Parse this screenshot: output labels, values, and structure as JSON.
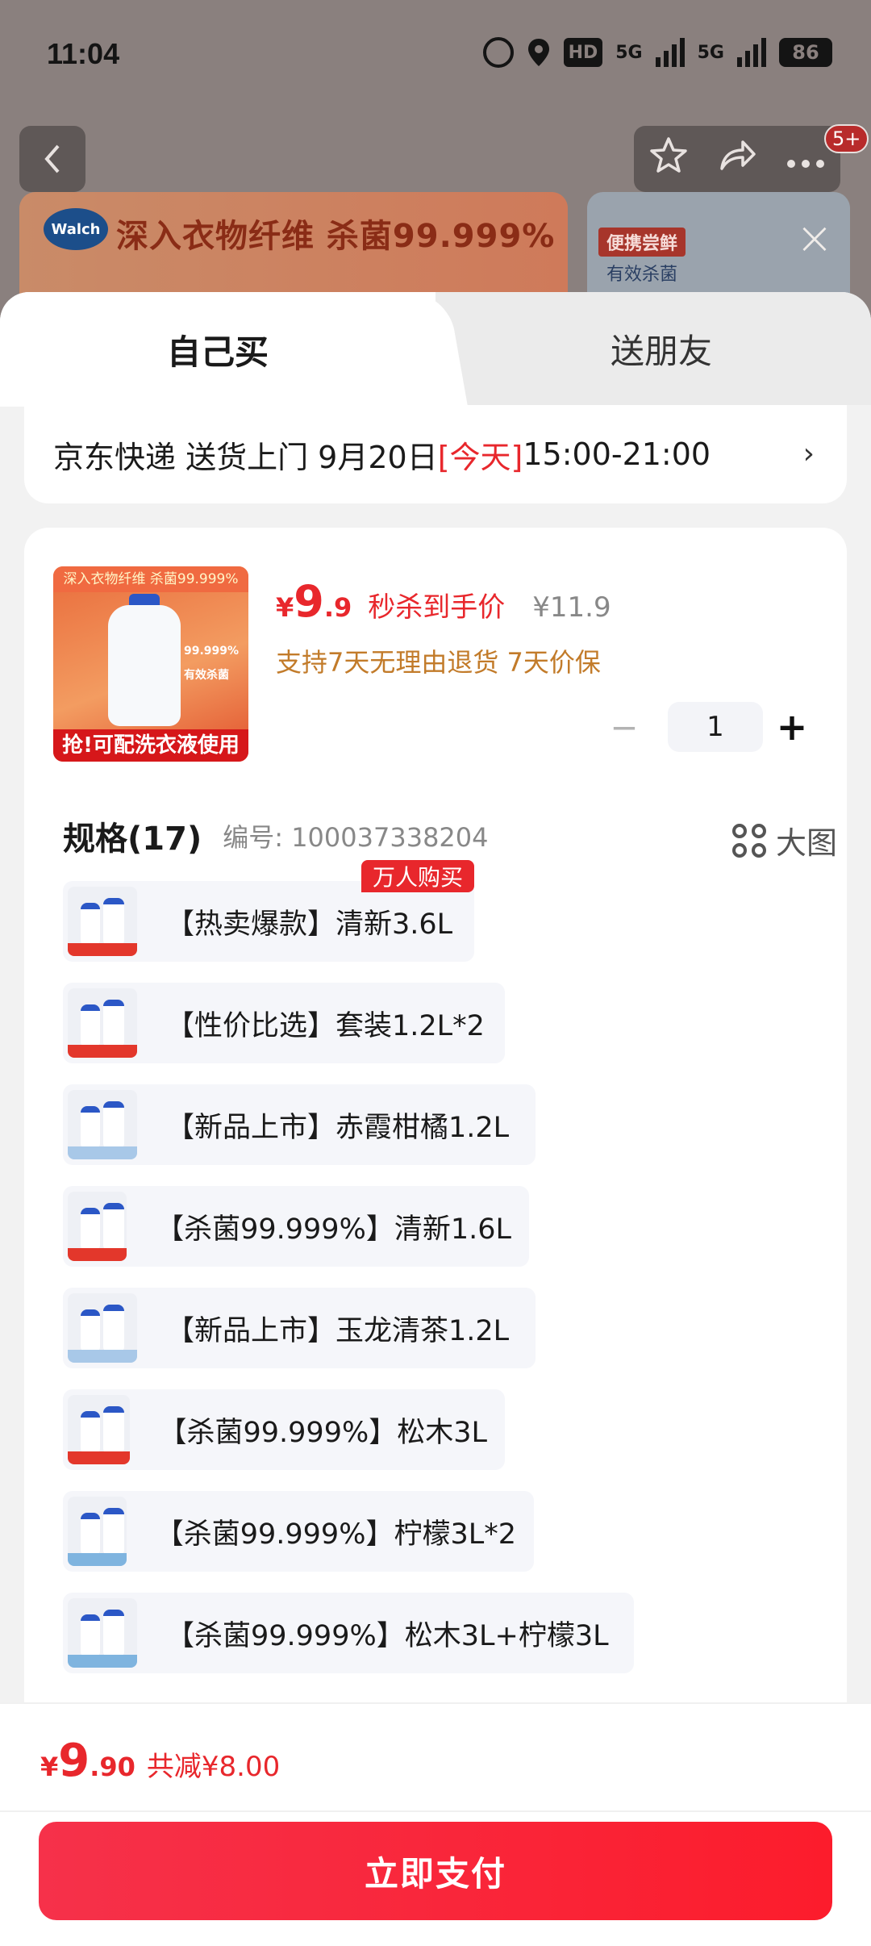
{
  "status_bar": {
    "time": "11:04",
    "network": "HD",
    "signal1": "5G",
    "signal2": "5G",
    "battery": "86"
  },
  "background": {
    "hero_logo": "Walch",
    "hero_text": "深入衣物纤维 杀菌99.999%",
    "hero2_tag": "便携尝鲜",
    "hero2_text": "有效杀菌",
    "cart_badge": "5+",
    "icons": {
      "back": "back-chevron-icon",
      "star": "star-icon",
      "share": "share-icon",
      "more": "more-icon",
      "close": "close-icon"
    }
  },
  "tabs": {
    "self": "自己买",
    "friend": "送朋友"
  },
  "delivery": {
    "prefix": "京东快递 送货上门 9月20日 ",
    "today": "[今天]",
    "window": " 15:00-21:00",
    "arrow": "›"
  },
  "product": {
    "image_top": "深入衣物纤维 杀菌99.999%",
    "image_mid": "99.999%有效杀菌",
    "image_bottom": "抢!可配洗衣液使用",
    "price_yen": "¥",
    "price_int": "9",
    "price_dec": ".9",
    "price_tag": "秒杀到手价",
    "price_orig": "¥11.9",
    "promise": "支持7天无理由退货 7天价保",
    "quantity": "1",
    "minus": "−",
    "plus": "+"
  },
  "spec": {
    "title": "规格(17)",
    "id": "编号: 100037338204",
    "big_view": "大图",
    "hot_badge": "万人购买",
    "items": [
      {
        "label": "【热卖爆款】清新3.6L"
      },
      {
        "label": "【性价比选】套装1.2L*2"
      },
      {
        "label": "【新品上市】赤霞柑橘1.2L"
      },
      {
        "label": "【杀菌99.999%】清新1.6L"
      },
      {
        "label": "【新品上市】玉龙清茶1.2L"
      },
      {
        "label": "【杀菌99.999%】松木3L"
      },
      {
        "label": "【杀菌99.999%】柠檬3L*2"
      },
      {
        "label": "【杀菌99.999%】松木3L+柠檬3L"
      }
    ]
  },
  "bottom": {
    "total_yen": "¥",
    "total_int": "9",
    "total_dec": ".90",
    "total_save": "共减¥8.00",
    "pay_label": "立即支付"
  },
  "colors": {
    "accent": "#e8272c",
    "promise": "#c27b2a",
    "pay_start": "#f6314a",
    "pay_end": "#fc1c2c"
  }
}
